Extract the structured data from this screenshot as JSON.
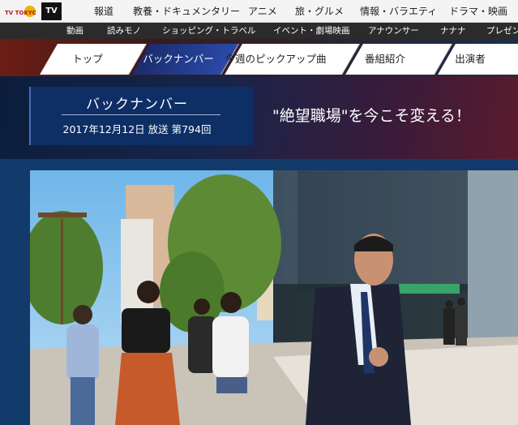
{
  "header": {
    "logo_text": "TV TOKYO",
    "tv_logo": "TV",
    "nav": [
      "報道",
      "教養・ドキュメンタリー",
      "アニメ",
      "旅・グルメ",
      "情報・バラエティ",
      "ドラマ・映画"
    ]
  },
  "subnav": [
    "動画",
    "読みモノ",
    "ショッピング・トラベル",
    "イベント・劇場映画",
    "アナウンサー",
    "ナナナ",
    "プレゼン"
  ],
  "tabs": [
    {
      "label": "トップ",
      "active": false
    },
    {
      "label": "バックナンバー",
      "active": true
    },
    {
      "label": "今週のピックアップ曲",
      "active": false
    },
    {
      "label": "番組紹介",
      "active": false
    },
    {
      "label": "出演者",
      "active": false
    }
  ],
  "banner": {
    "title": "バックナンバー",
    "date": "2017年12月12日 放送 第794回",
    "headline": "\"絶望職場\"を今こそ変える！"
  },
  "colors": {
    "active_tab": "#1b2c6e",
    "banner_box": "#0e2e66",
    "subbar": "#2b2b2b"
  }
}
